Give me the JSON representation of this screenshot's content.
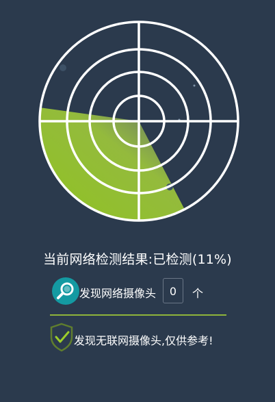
{
  "radar": {
    "progress_percent": 11,
    "colors": {
      "ring": "#ffffff",
      "sweep": "#9ccd2a",
      "background": "#2b3a4d"
    }
  },
  "status": {
    "text": "当前网络检测结果:已检测(11%)"
  },
  "camera_row": {
    "icon": "search-icon",
    "label": "发现网络摄像头",
    "count": "0",
    "unit": "个"
  },
  "safe_row": {
    "icon": "shield-check-icon",
    "text": "发现无联网摄像头,仅供参考!"
  },
  "accent_color": "#8fb53a"
}
